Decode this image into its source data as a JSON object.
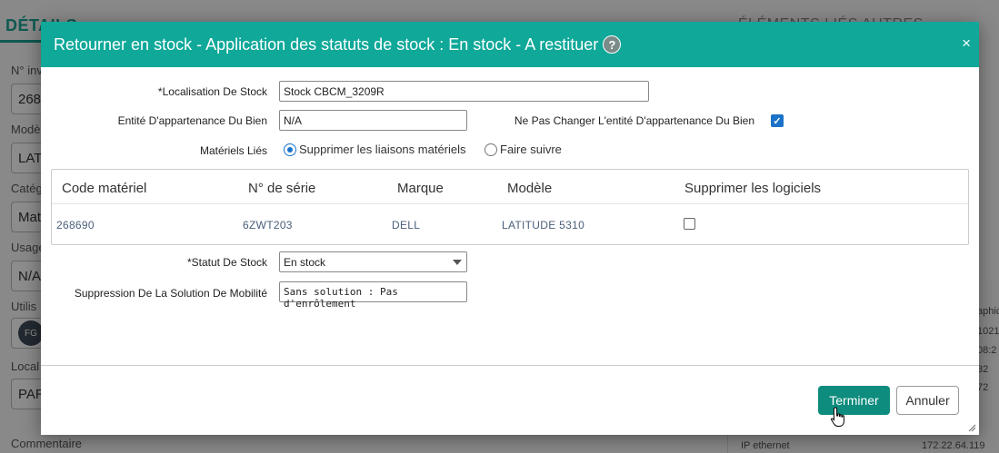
{
  "background": {
    "tab_label": "DÉTAILS",
    "right_tabs": "ÉLÉMENTS LIÉS    AUTRES",
    "fields": [
      {
        "label": "N° inv",
        "value": "268"
      },
      {
        "label": "Modè",
        "value": "LAT"
      },
      {
        "label": "Catég",
        "value": "Mat"
      },
      {
        "label": "Usage",
        "value": "N/A"
      },
      {
        "label": "Utilis",
        "value": ""
      },
      {
        "label": "Local",
        "value": "PAR"
      }
    ],
    "avatar_initials": "FG",
    "comment_label": "Commentaire",
    "right_values": [
      "aphic",
      "1021",
      "08:2",
      "32",
      "72"
    ],
    "ip_label": "IP ethernet",
    "ip_value": "172.22.64.119"
  },
  "modal": {
    "title": "Retourner en stock - Application des statuts de stock : En stock - A restituer",
    "help_glyph": "?",
    "close_glyph": "×",
    "localisation": {
      "label": "*Localisation De Stock",
      "value": "Stock CBCM_3209R"
    },
    "entite": {
      "label": "Entité D'appartenance Du Bien",
      "value": "N/A"
    },
    "ne_pas_changer": {
      "label": "Ne Pas Changer L'entité D'appartenance Du Bien",
      "checked": true
    },
    "materiels_lies": {
      "label": "Matériels Liés",
      "options": [
        "Supprimer les liaisons matériels",
        "Faire suivre"
      ],
      "selected": "Supprimer les liaisons matériels"
    },
    "table": {
      "headers": [
        "Code matériel",
        "N° de série",
        "Marque",
        "Modèle",
        "Supprimer les logiciels"
      ],
      "rows": [
        {
          "code": "268690",
          "serie": "6ZWT203",
          "marque": "DELL",
          "modele": "LATITUDE 5310",
          "supprimer": false
        }
      ]
    },
    "statut": {
      "label": "*Statut De Stock",
      "value": "En stock"
    },
    "suppression": {
      "label": "Suppression De La Solution De Mobilité",
      "value": "Sans solution : Pas d'enrôlement"
    },
    "buttons": {
      "primary": "Terminer",
      "secondary": "Annuler"
    }
  },
  "colors": {
    "header": "#0fa899",
    "primary_button": "#0e8c7e",
    "checkbox": "#1a73c9"
  }
}
